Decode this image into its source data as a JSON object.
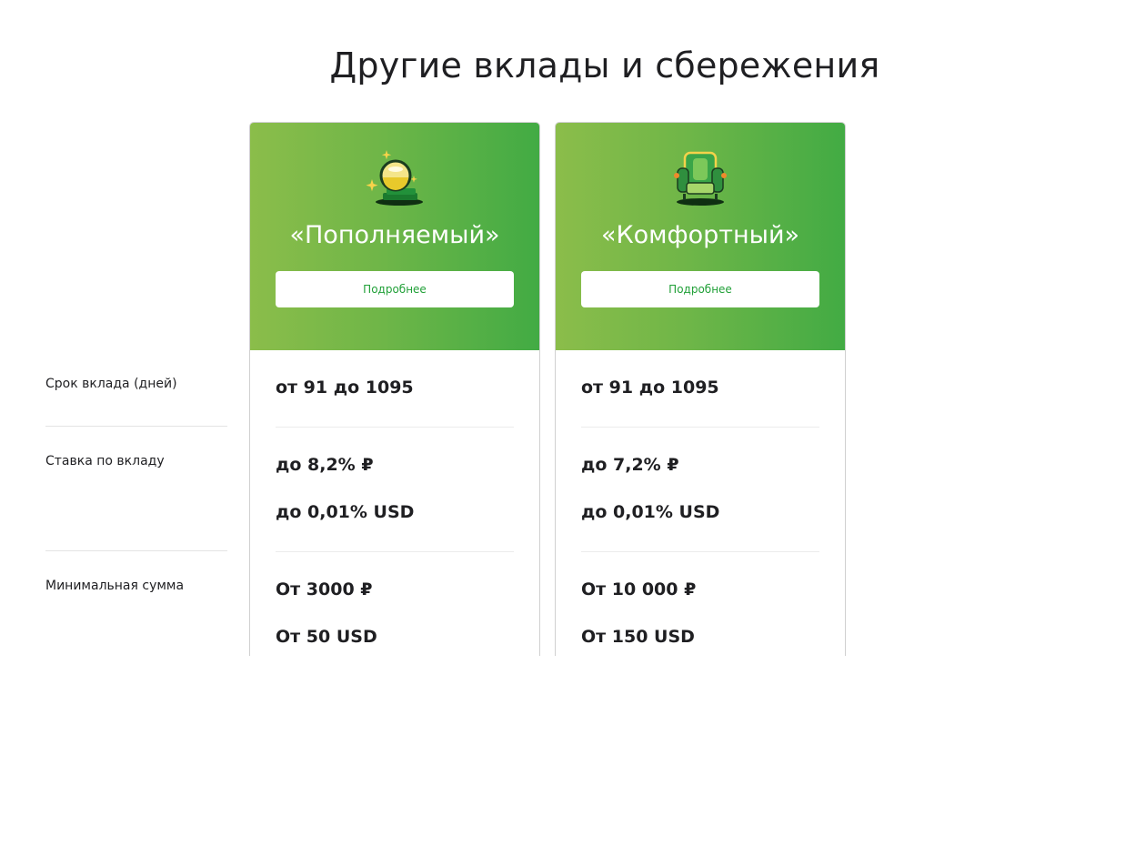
{
  "page": {
    "title": "Другие вклады и сбережения"
  },
  "rows": {
    "term_label": "Срок вклада (дней)",
    "rate_label": "Ставка по вкладу",
    "min_label": "Минимальная сумма"
  },
  "cards": [
    {
      "title": "«Пополняемый»",
      "button_label": "Подробнее",
      "icon": "coin-stack-icon",
      "term": "от 91 до 1095",
      "rate_rub": "до 8,2% ₽",
      "rate_usd": "до 0,01% USD",
      "min_rub": "От 3000 ₽",
      "min_usd": "От 50 USD"
    },
    {
      "title": "«Комфортный»",
      "button_label": "Подробнее",
      "icon": "armchair-icon",
      "term": "от 91 до 1095",
      "rate_rub": "до 7,2% ₽",
      "rate_usd": "до 0,01% USD",
      "min_rub": "От 10 000 ₽",
      "min_usd": "От 150 USD"
    }
  ],
  "colors": {
    "accent": "#21a038",
    "gradient_start": "#8bbd4a",
    "gradient_end": "#42ab44"
  }
}
